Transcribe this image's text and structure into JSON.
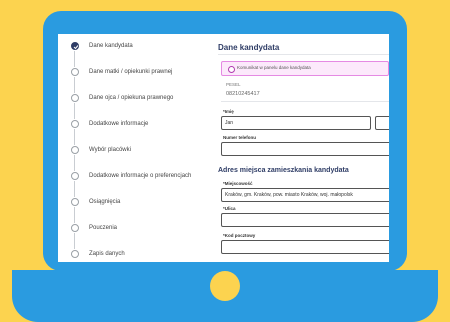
{
  "sidebar": {
    "steps": [
      {
        "label": "Dane kandydata",
        "state": "done"
      },
      {
        "label": "Dane matki / opiekunki prawnej",
        "state": "todo"
      },
      {
        "label": "Dane ojca / opiekuna prawnego",
        "state": "todo"
      },
      {
        "label": "Dodatkowe informacje",
        "state": "todo"
      },
      {
        "label": "Wybór placówki",
        "state": "todo"
      },
      {
        "label": "Dodatkowe informacje o preferencjach",
        "state": "todo"
      },
      {
        "label": "Osiągnięcia",
        "state": "todo"
      },
      {
        "label": "Pouczenia",
        "state": "todo"
      },
      {
        "label": "Zapis danych",
        "state": "todo"
      }
    ]
  },
  "main": {
    "title": "Dane kandydata",
    "alert": "Komunikat w panelu dane kandydata",
    "pesel_label": "PESEL",
    "pesel_value": "08210245417",
    "first_name_label": "*Imię",
    "first_name_value": "Jan",
    "phone_label": "Numer telefonu",
    "phone_value": "",
    "address_title": "Adres miejsca zamieszkania kandydata",
    "city_label": "*Miejscowość",
    "city_value": "Kraków, gm. Kraków, pow. miasto Kraków, woj. małopolsk",
    "street_label": "*Ulica",
    "street_value": "",
    "postal_label": "*Kod pocztowy",
    "postal_value": ""
  },
  "colors": {
    "background": "#fcd34f",
    "laptop": "#2a9be0",
    "accent": "#2f3d66",
    "alert_border": "#e58ae3"
  }
}
